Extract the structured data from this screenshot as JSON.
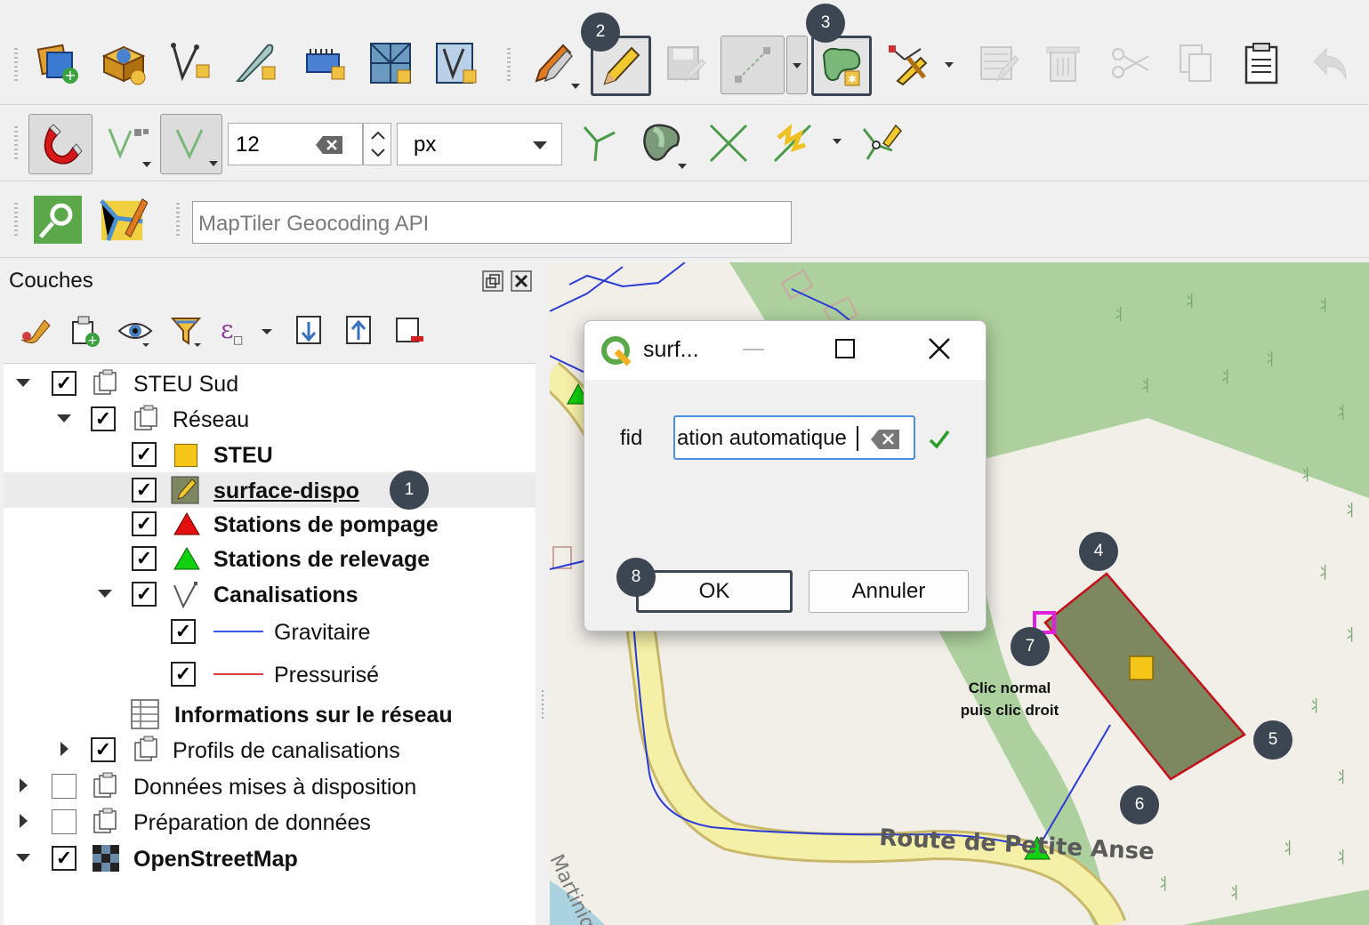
{
  "toolbar_top": {
    "badges": {
      "edit": "2",
      "add_polygon": "3"
    }
  },
  "snapping": {
    "tolerance_value": "12",
    "unit_value": "px"
  },
  "locator": {
    "placeholder": "MapTiler Geocoding API"
  },
  "layers_panel": {
    "title": "Couches",
    "items": [
      {
        "label": "STEU Sud",
        "checked": true
      },
      {
        "label": "Réseau",
        "checked": true
      },
      {
        "label": "STEU",
        "checked": true
      },
      {
        "label": "surface-dispo",
        "checked": true
      },
      {
        "label": "Stations de pompage",
        "checked": true
      },
      {
        "label": "Stations de relevage",
        "checked": true
      },
      {
        "label": "Canalisations",
        "checked": true
      },
      {
        "label": "Gravitaire",
        "checked": true
      },
      {
        "label": "Pressurisé",
        "checked": true
      },
      {
        "label": "Informations sur le réseau"
      },
      {
        "label": "Profils de canalisations",
        "checked": true
      },
      {
        "label": "Données mises à disposition",
        "checked": false
      },
      {
        "label": "Préparation de données",
        "checked": false
      },
      {
        "label": "OpenStreetMap",
        "checked": true
      }
    ],
    "badge": "1"
  },
  "dialog": {
    "title": "surf...",
    "field_label": "fid",
    "field_value": "ation automatique",
    "ok_label": "OK",
    "cancel_label": "Annuler",
    "badge": "8"
  },
  "map": {
    "road_label": "Route de Petite Anse",
    "road_label_2": "Martiniq",
    "annotation": "Clic normal\npuis clic droit",
    "annotation_line1": "Clic normal",
    "annotation_line2": "puis clic droit",
    "badges": {
      "b4": "4",
      "b5": "5",
      "b6": "6",
      "b7": "7"
    }
  },
  "colors": {
    "badge_bg": "#3b4652",
    "polygon_fill": "#7e8860",
    "polygon_stroke": "#c4101a",
    "pipe_blue": "#2b3bd8",
    "road_fill": "#f5f0a8",
    "forest": "#add19e",
    "vertex_magenta": "#e020e0"
  },
  "icons": [
    "new-project-icon",
    "new-layer-icon",
    "new-vector-icon",
    "new-scratch-icon",
    "new-raster-icon",
    "new-grid-icon",
    "new-virtual-icon",
    "edits-icon",
    "toggle-edit-icon",
    "save-edits-icon",
    "digitize-line-icon",
    "add-polygon-icon",
    "vertex-tool-icon",
    "modify-attributes-icon",
    "delete-icon",
    "cut-icon",
    "copy-icon",
    "paste-icon",
    "undo-icon",
    "magnet-icon",
    "snap-vertex-icon",
    "snap-mode-icon",
    "topology-icon",
    "trace-icon",
    "intersection-icon",
    "self-snap-icon",
    "split-icon",
    "locate-icon",
    "map-tips-icon"
  ]
}
